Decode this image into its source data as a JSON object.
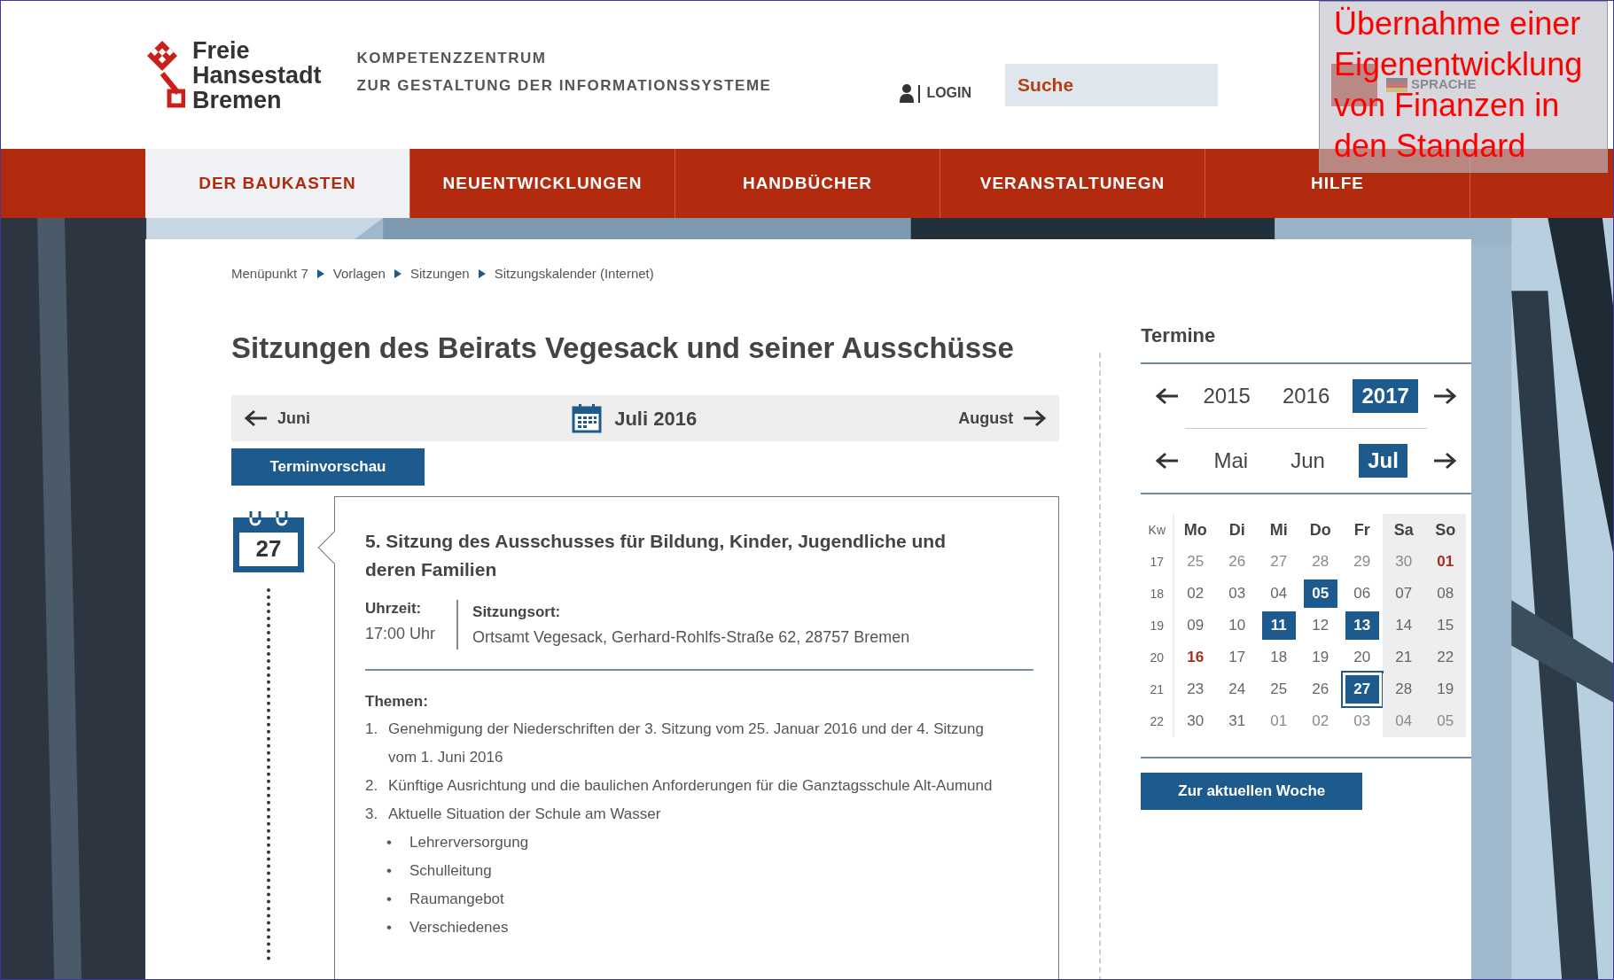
{
  "header": {
    "logo_lines": [
      "Freie",
      "Hansestadt",
      "Bremen"
    ],
    "subtitle_lines": [
      "KOMPETENZZENTRUM",
      "ZUR GESTALTUNG DER INFORMATIONSSYSTEME"
    ],
    "login": "LOGIN",
    "search": {
      "placeholder": "Suche"
    },
    "language": "SPRACHE"
  },
  "nav": [
    {
      "label": "DER BAUKASTEN",
      "selected": true
    },
    {
      "label": "NEUENTWICKLUNGEN",
      "selected": false
    },
    {
      "label": "HANDBÜCHER",
      "selected": false
    },
    {
      "label": "VERANSTALTUNEGN",
      "selected": false
    },
    {
      "label": "HILFE",
      "selected": false
    }
  ],
  "breadcrumb": [
    "Menüpunkt 7",
    "Vorlagen",
    "Sitzungen",
    "Sitzungskalender (Internet)"
  ],
  "title": "Sitzungen des Beirats Vegesack und seiner Ausschüsse",
  "month_nav": {
    "previous": "Juni",
    "current": "Juli 2016",
    "next": "August"
  },
  "preview_button": "Terminvorschau",
  "event": {
    "day": "27",
    "title": "5. Sitzung des Ausschusses für Bildung, Kinder, Jugendliche und deren Familien",
    "time_label": "Uhrzeit:",
    "time": "17:00 Uhr",
    "place_label": "Sitzungsort:",
    "place": "Ortsamt Vegesack, Gerhard-Rohlfs-Straße 62, 28757 Bremen",
    "topics_label": "Themen:",
    "topics": [
      {
        "number": "1.",
        "text": "Genehmigung der Niederschriften der 3. Sitzung vom 25. Januar 2016 und der 4. Sitzung vom 1. Juni 2016"
      },
      {
        "number": "2.",
        "text": "Künftige Ausrichtung und die baulichen Anforderungen für die Ganztagsschule Alt-Aumund"
      },
      {
        "number": "3.",
        "text": "Aktuelle Situation der Schule am Wasser",
        "children": [
          {
            "number": "•",
            "text": "Lehrerversorgung"
          },
          {
            "number": "•",
            "text": "Schulleitung"
          },
          {
            "number": "•",
            "text": "Raumangebot"
          },
          {
            "number": "•",
            "text": "Verschiedenes"
          }
        ]
      }
    ]
  },
  "sidebar": {
    "title": "Termine",
    "years": [
      {
        "label": "2015",
        "selected": false
      },
      {
        "label": "2016",
        "selected": false
      },
      {
        "label": "2017",
        "selected": true
      }
    ],
    "months": [
      {
        "label": "Mai",
        "selected": false
      },
      {
        "label": "Jun",
        "selected": false
      },
      {
        "label": "Jul",
        "selected": true
      }
    ],
    "week_label": "Kw",
    "weekdays": [
      {
        "label": "Mo",
        "weekend": false
      },
      {
        "label": "Di",
        "weekend": false
      },
      {
        "label": "Mi",
        "weekend": false
      },
      {
        "label": "Do",
        "weekend": false
      },
      {
        "label": "Fr",
        "weekend": false
      },
      {
        "label": "Sa",
        "weekend": true
      },
      {
        "label": "So",
        "weekend": true
      }
    ],
    "weeks": [
      {
        "kw": "17",
        "days": [
          {
            "label": "25",
            "kind": "outside"
          },
          {
            "label": "26",
            "kind": "outside"
          },
          {
            "label": "27",
            "kind": "outside"
          },
          {
            "label": "28",
            "kind": "outside"
          },
          {
            "label": "29",
            "kind": "outside"
          },
          {
            "label": "30",
            "kind": "outside"
          },
          {
            "label": "01",
            "kind": "holiday"
          }
        ]
      },
      {
        "kw": "18",
        "days": [
          {
            "label": "02",
            "kind": "normal"
          },
          {
            "label": "03",
            "kind": "normal"
          },
          {
            "label": "04",
            "kind": "normal"
          },
          {
            "label": "05",
            "kind": "event"
          },
          {
            "label": "06",
            "kind": "normal"
          },
          {
            "label": "07",
            "kind": "normal"
          },
          {
            "label": "08",
            "kind": "normal"
          }
        ]
      },
      {
        "kw": "19",
        "days": [
          {
            "label": "09",
            "kind": "normal"
          },
          {
            "label": "10",
            "kind": "normal"
          },
          {
            "label": "11",
            "kind": "event"
          },
          {
            "label": "12",
            "kind": "normal"
          },
          {
            "label": "13",
            "kind": "event"
          },
          {
            "label": "14",
            "kind": "normal"
          },
          {
            "label": "15",
            "kind": "normal"
          }
        ]
      },
      {
        "kw": "20",
        "days": [
          {
            "label": "16",
            "kind": "holiday"
          },
          {
            "label": "17",
            "kind": "normal"
          },
          {
            "label": "18",
            "kind": "normal"
          },
          {
            "label": "19",
            "kind": "normal"
          },
          {
            "label": "20",
            "kind": "normal"
          },
          {
            "label": "21",
            "kind": "normal"
          },
          {
            "label": "22",
            "kind": "normal"
          }
        ]
      },
      {
        "kw": "21",
        "days": [
          {
            "label": "23",
            "kind": "normal"
          },
          {
            "label": "24",
            "kind": "normal"
          },
          {
            "label": "25",
            "kind": "normal"
          },
          {
            "label": "26",
            "kind": "normal"
          },
          {
            "label": "27",
            "kind": "current"
          },
          {
            "label": "28",
            "kind": "normal"
          },
          {
            "label": "19",
            "kind": "normal"
          }
        ]
      },
      {
        "kw": "22",
        "days": [
          {
            "label": "30",
            "kind": "normal"
          },
          {
            "label": "31",
            "kind": "normal"
          },
          {
            "label": "01",
            "kind": "outside"
          },
          {
            "label": "02",
            "kind": "outside"
          },
          {
            "label": "03",
            "kind": "outside"
          },
          {
            "label": "04",
            "kind": "outside"
          },
          {
            "label": "05",
            "kind": "outside"
          }
        ]
      }
    ],
    "week_button": "Zur aktuellen Woche"
  },
  "callout": "Übernahme einer Eigenentwicklung von Finanzen in den Standard"
}
